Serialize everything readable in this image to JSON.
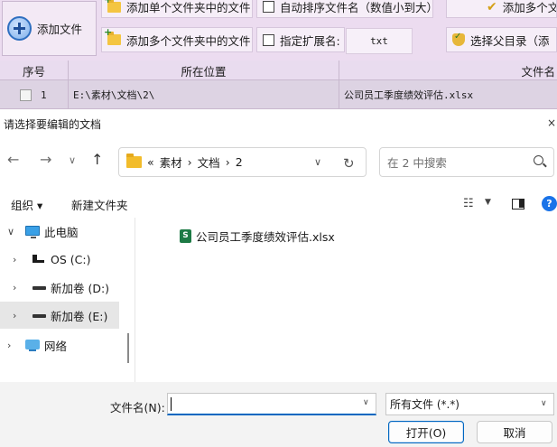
{
  "app": {
    "add_file_button": "添加文件",
    "toolbar": {
      "add_single_folder_files": "添加单个文件夹中的文件",
      "auto_sort": "自动排序文件名（数值小到大）",
      "add_multi_right": "添加多个文",
      "add_multi_folder_files": "添加多个文件夹中的文件",
      "specify_ext": "指定扩展名:",
      "ext_value": "txt",
      "select_parent": "选择父目录（添"
    },
    "grid": {
      "columns": [
        "序号",
        "所在位置",
        "文件名"
      ],
      "rows": [
        {
          "index": "1",
          "location": "E:\\素材\\文档\\2\\",
          "filename": "公司员工季度绩效评估.xlsx"
        }
      ]
    }
  },
  "dialog": {
    "title": "请选择要编辑的文档",
    "close_glyph": "×",
    "nav": {
      "back": "←",
      "forward": "→",
      "recent": "∨",
      "up": "↑"
    },
    "breadcrumb": {
      "overflow": "«",
      "parts": [
        "素材",
        "›",
        "文档",
        "›",
        "2"
      ]
    },
    "search_placeholder": "在 2 中搜索",
    "commands": {
      "organize": "组织 ▾",
      "new_folder": "新建文件夹"
    },
    "nav_pane": [
      {
        "label": "此电脑",
        "arrow": "∨",
        "icon": "computer-icon"
      },
      {
        "label": "OS (C:)",
        "arrow": "›",
        "icon": "os-drive-icon"
      },
      {
        "label": "新加卷 (D:)",
        "arrow": "›",
        "icon": "drive-icon"
      },
      {
        "label": "新加卷 (E:)",
        "arrow": "›",
        "icon": "drive-icon"
      },
      {
        "label": "网络",
        "arrow": "›",
        "icon": "network-icon"
      }
    ],
    "files": [
      {
        "name": "公司员工季度绩效评估.xlsx",
        "icon": "excel-file-icon"
      }
    ],
    "filename_label": "文件名(N):",
    "filename_value": "",
    "file_type": "所有文件 (*.*)",
    "open_button": "打开(O)",
    "cancel_button": "取消",
    "accent": "#0067c0"
  }
}
